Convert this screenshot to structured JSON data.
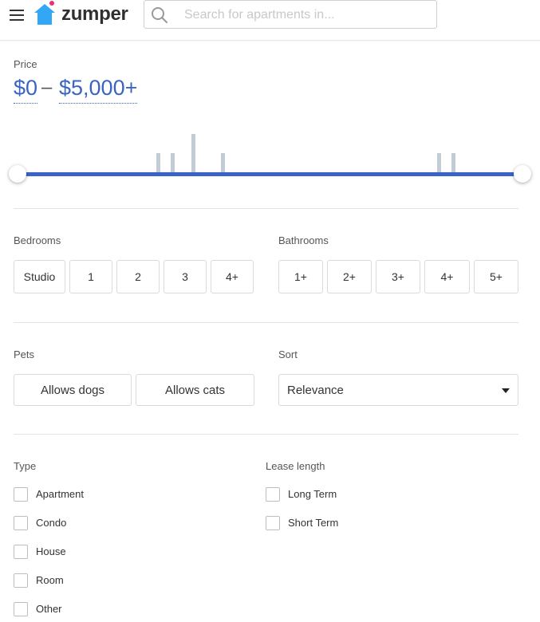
{
  "header": {
    "logo_text": "zumper",
    "search_placeholder": "Search for apartments in..."
  },
  "price": {
    "label": "Price",
    "min": "$0",
    "separator": "–",
    "max": "$5,000+",
    "range_fraction": [
      0,
      1
    ]
  },
  "bedrooms": {
    "label": "Bedrooms",
    "options": [
      "Studio",
      "1",
      "2",
      "3",
      "4+"
    ]
  },
  "bathrooms": {
    "label": "Bathrooms",
    "options": [
      "1+",
      "2+",
      "3+",
      "4+",
      "5+"
    ]
  },
  "pets": {
    "label": "Pets",
    "options": [
      "Allows dogs",
      "Allows cats"
    ]
  },
  "sort": {
    "label": "Sort",
    "selected": "Relevance"
  },
  "type": {
    "label": "Type",
    "options": [
      "Apartment",
      "Condo",
      "House",
      "Room",
      "Other"
    ]
  },
  "lease": {
    "label": "Lease length",
    "options": [
      "Long Term",
      "Short Term"
    ]
  },
  "colors": {
    "accent": "#3764c8",
    "histogram": "#c2ccd4",
    "logo_house": "#33a6f5",
    "logo_dot": "#f0306e"
  },
  "icons": [
    "menu-icon",
    "zumper-logo-icon",
    "search-icon",
    "chevron-down-icon"
  ]
}
